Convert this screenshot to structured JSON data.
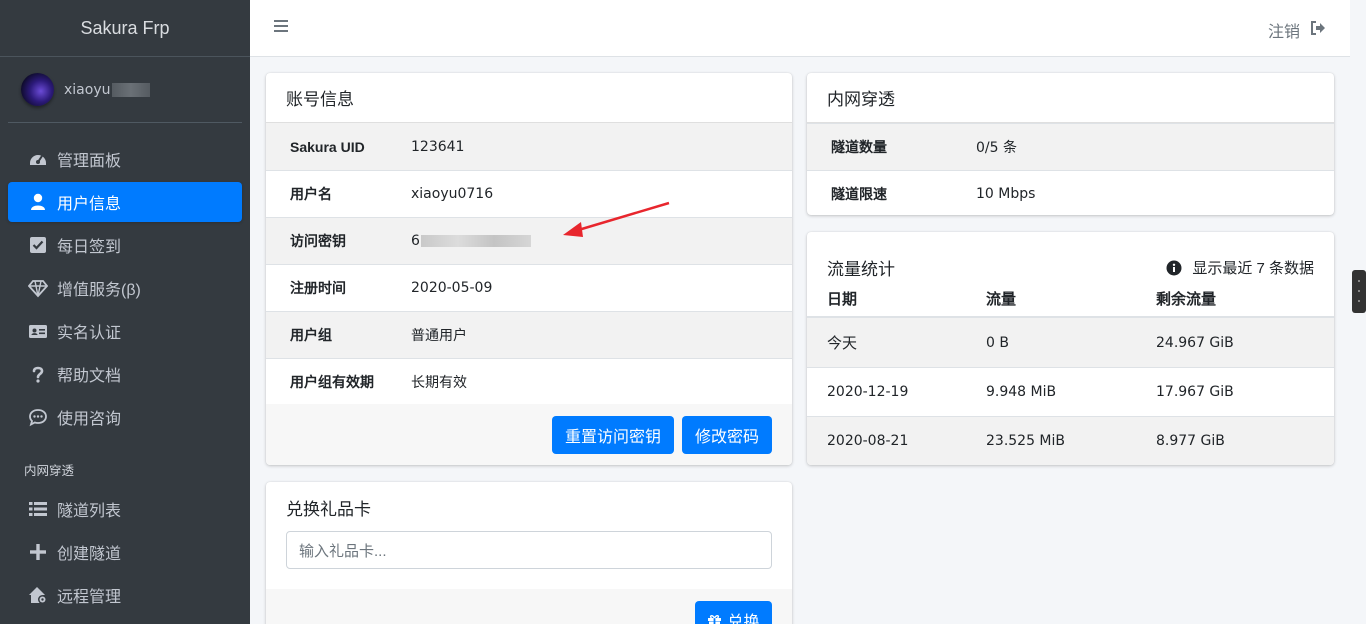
{
  "sidebar": {
    "brand": "Sakura Frp",
    "user": {
      "name": "xiaoyu"
    },
    "items": [
      {
        "label": "管理面板",
        "icon": "tachometer-icon",
        "active": false
      },
      {
        "label": "用户信息",
        "icon": "user-icon",
        "active": true
      },
      {
        "label": "每日签到",
        "icon": "check-square-icon",
        "active": false
      },
      {
        "label": "增值服务(β)",
        "icon": "diamond-icon",
        "active": false
      },
      {
        "label": "实名认证",
        "icon": "id-card-icon",
        "active": false
      },
      {
        "label": "帮助文档",
        "icon": "question-icon",
        "active": false
      },
      {
        "label": "使用咨询",
        "icon": "comment-dots-icon",
        "active": false
      }
    ],
    "section_header": "内网穿透",
    "section_items": [
      {
        "label": "隧道列表",
        "icon": "list-icon"
      },
      {
        "label": "创建隧道",
        "icon": "plus-icon"
      },
      {
        "label": "远程管理",
        "icon": "house-gear-icon"
      }
    ]
  },
  "topbar": {
    "logout_label": "注销",
    "menu_icon": "hamburger-icon",
    "logout_icon": "sign-out-icon"
  },
  "account": {
    "title": "账号信息",
    "rows": [
      {
        "key": "Sakura UID",
        "value": "123641"
      },
      {
        "key": "用户名",
        "value": "xiaoyu0716"
      },
      {
        "key": "访问密钥",
        "value": "6"
      },
      {
        "key": "注册时间",
        "value": "2020-05-09"
      },
      {
        "key": "用户组",
        "value": "普通用户"
      },
      {
        "key": "用户组有效期",
        "value": "长期有效"
      }
    ],
    "reset_key_button": "重置访问密钥",
    "change_password_button": "修改密码"
  },
  "giftcard": {
    "title": "兑换礼品卡",
    "placeholder": "输入礼品卡...",
    "redeem_button": "兑换"
  },
  "tunnel": {
    "title": "内网穿透",
    "rows": [
      {
        "key": "隧道数量",
        "value": "0/5 条"
      },
      {
        "key": "隧道限速",
        "value": "10 Mbps"
      }
    ]
  },
  "traffic": {
    "title": "流量统计",
    "hint": "显示最近 7 条数据",
    "columns": [
      "日期",
      "流量",
      "剩余流量"
    ],
    "rows": [
      {
        "date": "今天",
        "used": "0 B",
        "remaining": "24.967 GiB"
      },
      {
        "date": "2020-12-19",
        "used": "9.948 MiB",
        "remaining": "17.967 GiB"
      },
      {
        "date": "2020-08-21",
        "used": "23.525 MiB",
        "remaining": "8.977 GiB"
      }
    ]
  },
  "colors": {
    "primary": "#007bff",
    "sidebar_bg": "#343a40",
    "annotation_arrow": "#e8262d"
  }
}
